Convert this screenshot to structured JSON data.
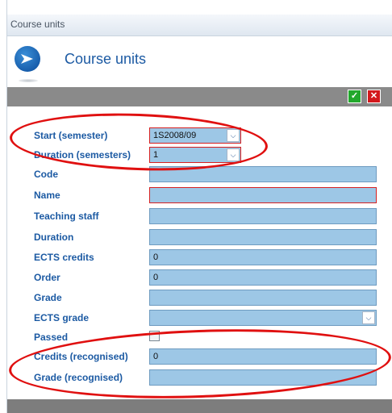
{
  "window": {
    "title": "Course units"
  },
  "header": {
    "title": "Course units",
    "logo": "arrow-logo-icon"
  },
  "toolbar": {
    "save_icon": "save-icon",
    "close_icon": "close-icon"
  },
  "form": {
    "fields": [
      {
        "label": "Start (semester)",
        "value": "1S2008/09"
      },
      {
        "label": "Duration (semesters)",
        "value": "1"
      },
      {
        "label": "Code",
        "value": ""
      },
      {
        "label": "Name",
        "value": ""
      },
      {
        "label": "Teaching staff",
        "value": ""
      },
      {
        "label": "Duration",
        "value": ""
      },
      {
        "label": "ECTS credits",
        "value": "0"
      },
      {
        "label": "Order",
        "value": "0"
      },
      {
        "label": "Grade",
        "value": ""
      },
      {
        "label": "ECTS grade",
        "value": ""
      },
      {
        "label": "Passed",
        "checked": false
      },
      {
        "label": "Credits (recognised)",
        "value": "0"
      },
      {
        "label": "Grade (recognised)",
        "value": ""
      }
    ]
  },
  "colors": {
    "accent": "#1c5aa3",
    "field_bg": "#9dc7e6",
    "required_border": "#d62020",
    "highlight": "#e01010"
  }
}
